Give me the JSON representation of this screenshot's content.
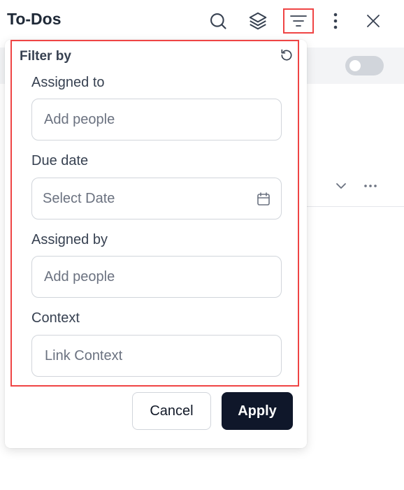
{
  "header": {
    "title": "To-Dos",
    "icons": [
      "search-icon",
      "layers-icon",
      "filter-icon",
      "more-vertical-icon",
      "close-icon"
    ]
  },
  "background": {
    "toggle_state": "off"
  },
  "filter_panel": {
    "title": "Filter by",
    "reset_icon": "reset-icon",
    "fields": {
      "assigned_to": {
        "label": "Assigned to",
        "placeholder": "Add people"
      },
      "due_date": {
        "label": "Due date",
        "placeholder": "Select Date",
        "icon": "calendar-icon"
      },
      "assigned_by": {
        "label": "Assigned by",
        "placeholder": "Add people"
      },
      "context": {
        "label": "Context",
        "placeholder": "Link Context"
      }
    },
    "buttons": {
      "cancel": "Cancel",
      "apply": "Apply"
    }
  },
  "colors": {
    "highlight": "#ef4444",
    "apply_bg": "#0f172a",
    "text": "#374151",
    "placeholder": "#6b7280"
  }
}
